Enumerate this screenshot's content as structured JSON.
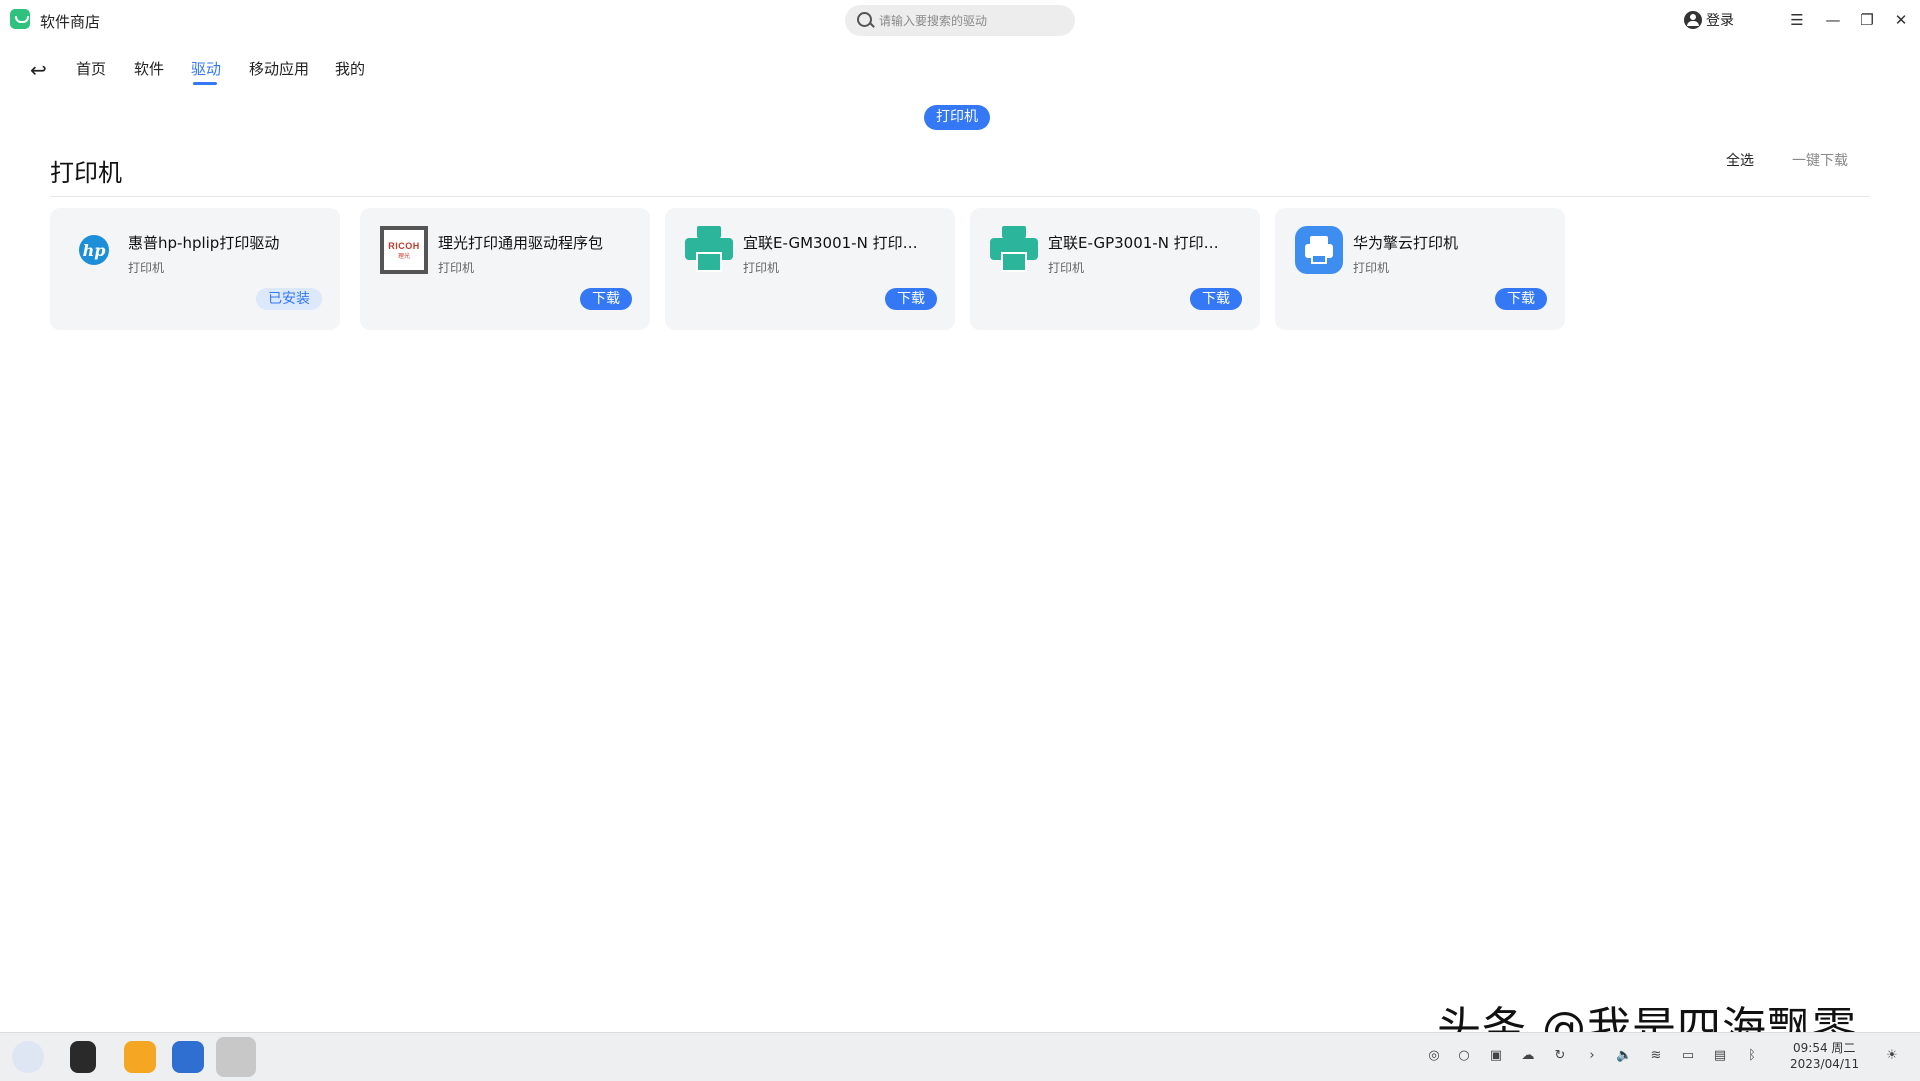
{
  "titlebar": {
    "app_title": "软件商店",
    "search_placeholder": "请输入要搜索的驱动",
    "login_label": "登录"
  },
  "nav": {
    "tabs": [
      {
        "label": "首页"
      },
      {
        "label": "软件"
      },
      {
        "label": "驱动",
        "active": true
      },
      {
        "label": "移动应用"
      },
      {
        "label": "我的"
      }
    ]
  },
  "filter": {
    "active_pill": "打印机"
  },
  "section": {
    "title": "打印机",
    "select_all": "全选",
    "one_click_download": "一键下载"
  },
  "cards": [
    {
      "name": "惠普hp-hplip打印驱动",
      "category": "打印机",
      "action": "已安装",
      "icon": "hp-logo-icon"
    },
    {
      "name": "理光打印通用驱动程序包",
      "category": "打印机",
      "action": "下载",
      "icon": "ricoh-logo-icon",
      "logo_text": "RICOH",
      "logo_subtext": "理光"
    },
    {
      "name": "宜联E-GM3001-N 打印…",
      "category": "打印机",
      "action": "下载",
      "icon": "printer-icon"
    },
    {
      "name": "宜联E-GP3001-N 打印…",
      "category": "打印机",
      "action": "下载",
      "icon": "printer-icon"
    },
    {
      "name": "华为擎云打印机",
      "category": "打印机",
      "action": "下载",
      "icon": "huawei-printer-icon"
    }
  ],
  "taskbar": {
    "time": "09:54 周二",
    "date": "2023/04/11"
  },
  "watermark": "头条 @我是四海飘零",
  "colors": {
    "accent": "#3478f6",
    "card_bg": "#f4f5f7",
    "printer_green": "#2bb59a"
  }
}
